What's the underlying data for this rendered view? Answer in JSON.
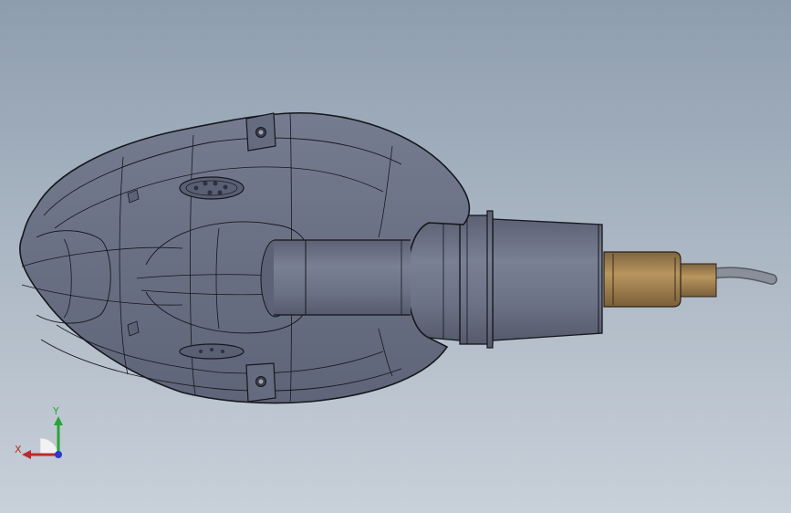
{
  "viewport": {
    "background_top": "#8e9dae",
    "background_bottom": "#c8d0d9"
  },
  "model": {
    "shell_color": "#6e7488",
    "cylinder_color": "#6c7285",
    "brass_color": "#a8875a",
    "cable_color": "#8a8f99",
    "edge_color": "#15171c"
  },
  "triad": {
    "x_label": "X",
    "y_label": "Y",
    "x_color": "#c0262c",
    "y_color": "#2aa43a",
    "z_color": "#2a39c8"
  }
}
